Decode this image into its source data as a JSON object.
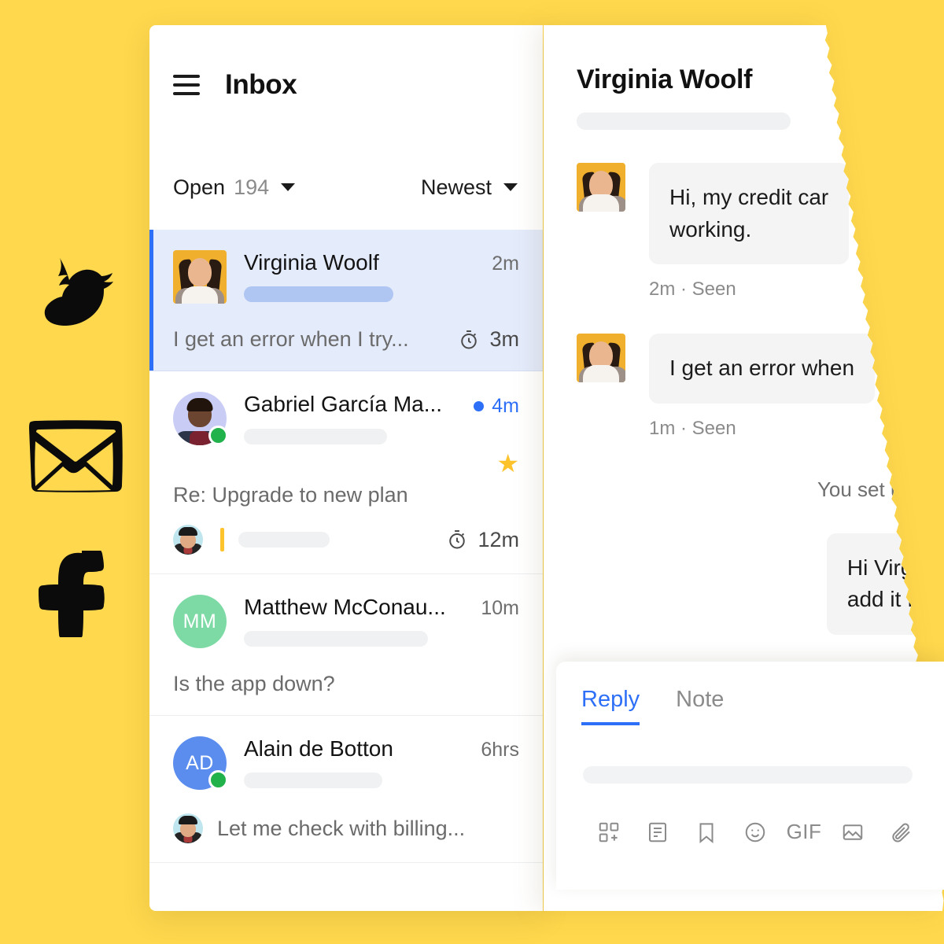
{
  "theme": {
    "background": "#ffd84d",
    "accent_blue": "#2d6ff7",
    "star_yellow": "#fcc32c",
    "online_green": "#22b24c",
    "selected_row": "#e4ebfb",
    "bubble_grey": "#f4f4f4"
  },
  "decorations": [
    {
      "name": "bird-icon",
      "label": "bird"
    },
    {
      "name": "envelope-icon",
      "label": "envelope"
    },
    {
      "name": "facebook-icon",
      "label": "facebook f"
    }
  ],
  "inbox": {
    "title": "Inbox",
    "menu_icon": "hamburger-icon",
    "filters": {
      "status_label": "Open",
      "status_count": "194",
      "sort_label": "Newest"
    },
    "conversations": [
      {
        "name": "Virginia Woolf",
        "time": "2m",
        "preview": "I get an error when I try...",
        "sla": "3m",
        "selected": true,
        "unread": false,
        "starred": false,
        "online": false,
        "avatar": "photo-virginia",
        "avatar_shape": "square"
      },
      {
        "name": "Gabriel García Ma...",
        "time": "4m",
        "preview": "Re: Upgrade to new plan",
        "sla": "12m",
        "selected": false,
        "unread": true,
        "starred": true,
        "online": true,
        "avatar": "photo-gabriel",
        "avatar_shape": "circle"
      },
      {
        "name": "Matthew McConau...",
        "time": "10m",
        "preview": "Is the app down?",
        "sla": "",
        "selected": false,
        "unread": false,
        "starred": false,
        "online": false,
        "avatar": "initials",
        "initials": "MM",
        "avatar_color": "#7ddaa5",
        "avatar_shape": "circle"
      },
      {
        "name": "Alain de Botton",
        "time": "6hrs",
        "preview": "Let me check with billing...",
        "sla": "",
        "selected": false,
        "unread": false,
        "starred": false,
        "online": true,
        "avatar": "initials",
        "initials": "AD",
        "avatar_color": "#5b8def",
        "avatar_shape": "circle"
      }
    ]
  },
  "conversation": {
    "title": "Virginia Woolf",
    "messages": [
      {
        "text": "Hi, my credit car",
        "text2": "working.",
        "meta": "2m · Seen",
        "side": "in"
      },
      {
        "text": "I get an error when",
        "text2": "",
        "meta": "1m · Seen",
        "side": "in"
      }
    ],
    "system_note": "You set urge",
    "outgoing": {
      "line1": "Hi Virginia",
      "line2": "add it for "
    }
  },
  "composer": {
    "tabs": [
      {
        "label": "Reply",
        "active": true
      },
      {
        "label": "Note",
        "active": false
      }
    ],
    "input_placeholder": "",
    "tools": [
      {
        "name": "apps-icon",
        "label": ""
      },
      {
        "name": "article-icon",
        "label": ""
      },
      {
        "name": "bookmark-icon",
        "label": ""
      },
      {
        "name": "emoji-icon",
        "label": ""
      },
      {
        "name": "gif-icon",
        "label": "GIF"
      },
      {
        "name": "image-icon",
        "label": ""
      },
      {
        "name": "attachment-icon",
        "label": ""
      }
    ]
  }
}
